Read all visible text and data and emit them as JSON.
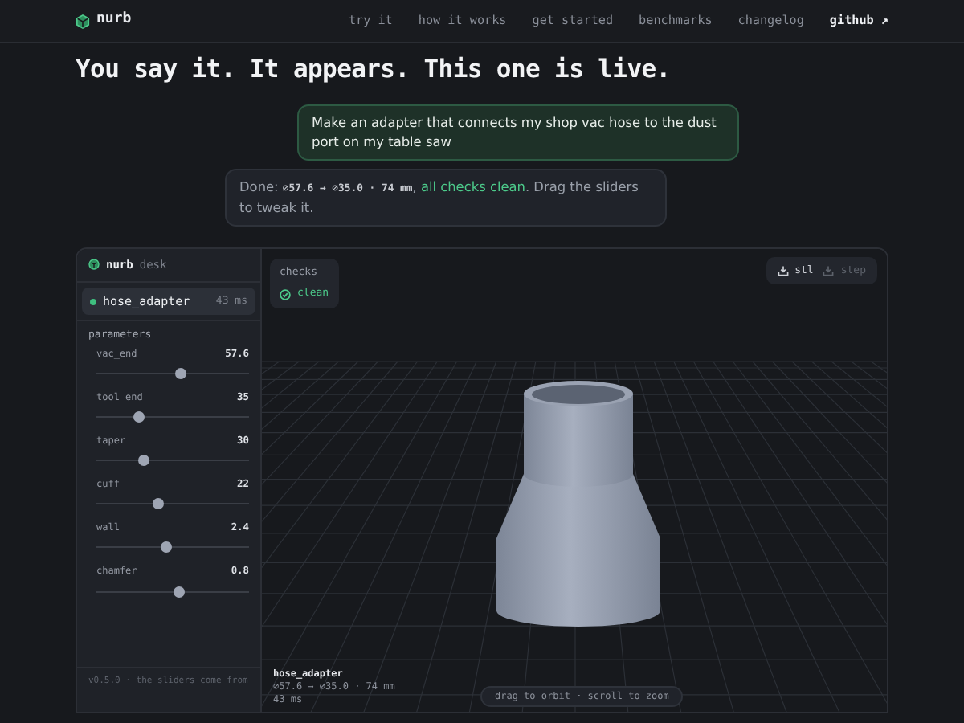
{
  "nav": {
    "brand": "nurb",
    "links": [
      {
        "label": "try it",
        "highlighted": false
      },
      {
        "label": "how it works",
        "highlighted": false
      },
      {
        "label": "get started",
        "highlighted": false
      },
      {
        "label": "benchmarks",
        "highlighted": false
      },
      {
        "label": "changelog",
        "highlighted": false
      },
      {
        "label": "github ↗",
        "highlighted": true
      }
    ]
  },
  "headline": "You say it. It appears. This one is live.",
  "prompt": "Make an adapter that connects my shop vac hose to the dust port on my table saw",
  "reply": [
    {
      "text": "Done: ",
      "kind": "plain"
    },
    {
      "text": "⌀57.6 → ⌀35.0 · 74 mm",
      "kind": "code"
    },
    {
      "text": ", ",
      "kind": "plain"
    },
    {
      "text": "all checks clean",
      "kind": "success"
    },
    {
      "text": ". Drag the sliders to tweak it.",
      "kind": "plain"
    }
  ],
  "desk": {
    "brand": "nurb",
    "subtitle": "desk",
    "part": {
      "name": "hose_adapter",
      "time": "43 ms",
      "color": "#3fbf7f",
      "selected": true
    },
    "parameters_title": "parameters",
    "parameters": [
      {
        "name": "vac_end",
        "value": "57.6",
        "level": 0.55
      },
      {
        "name": "tool_end",
        "value": "35",
        "level": 0.28
      },
      {
        "name": "taper",
        "value": "30",
        "level": 0.31
      },
      {
        "name": "cuff",
        "value": "22",
        "level": 0.4
      },
      {
        "name": "wall",
        "value": "2.4",
        "level": 0.46
      },
      {
        "name": "chamfer",
        "value": "0.8",
        "level": 0.54
      }
    ],
    "footer": "v0.5.0 · the sliders come from",
    "checks": {
      "title": "checks",
      "status": "clean",
      "passed": true
    },
    "exports": [
      {
        "label": "stl",
        "disabled": false
      },
      {
        "label": "step",
        "disabled": true
      }
    ],
    "model": {
      "name": "hose_adapter",
      "dimensions": "⌀57.6 → ⌀35.0 · 74 mm",
      "time": "43 ms"
    },
    "hint": "drag to orbit · scroll to zoom"
  }
}
